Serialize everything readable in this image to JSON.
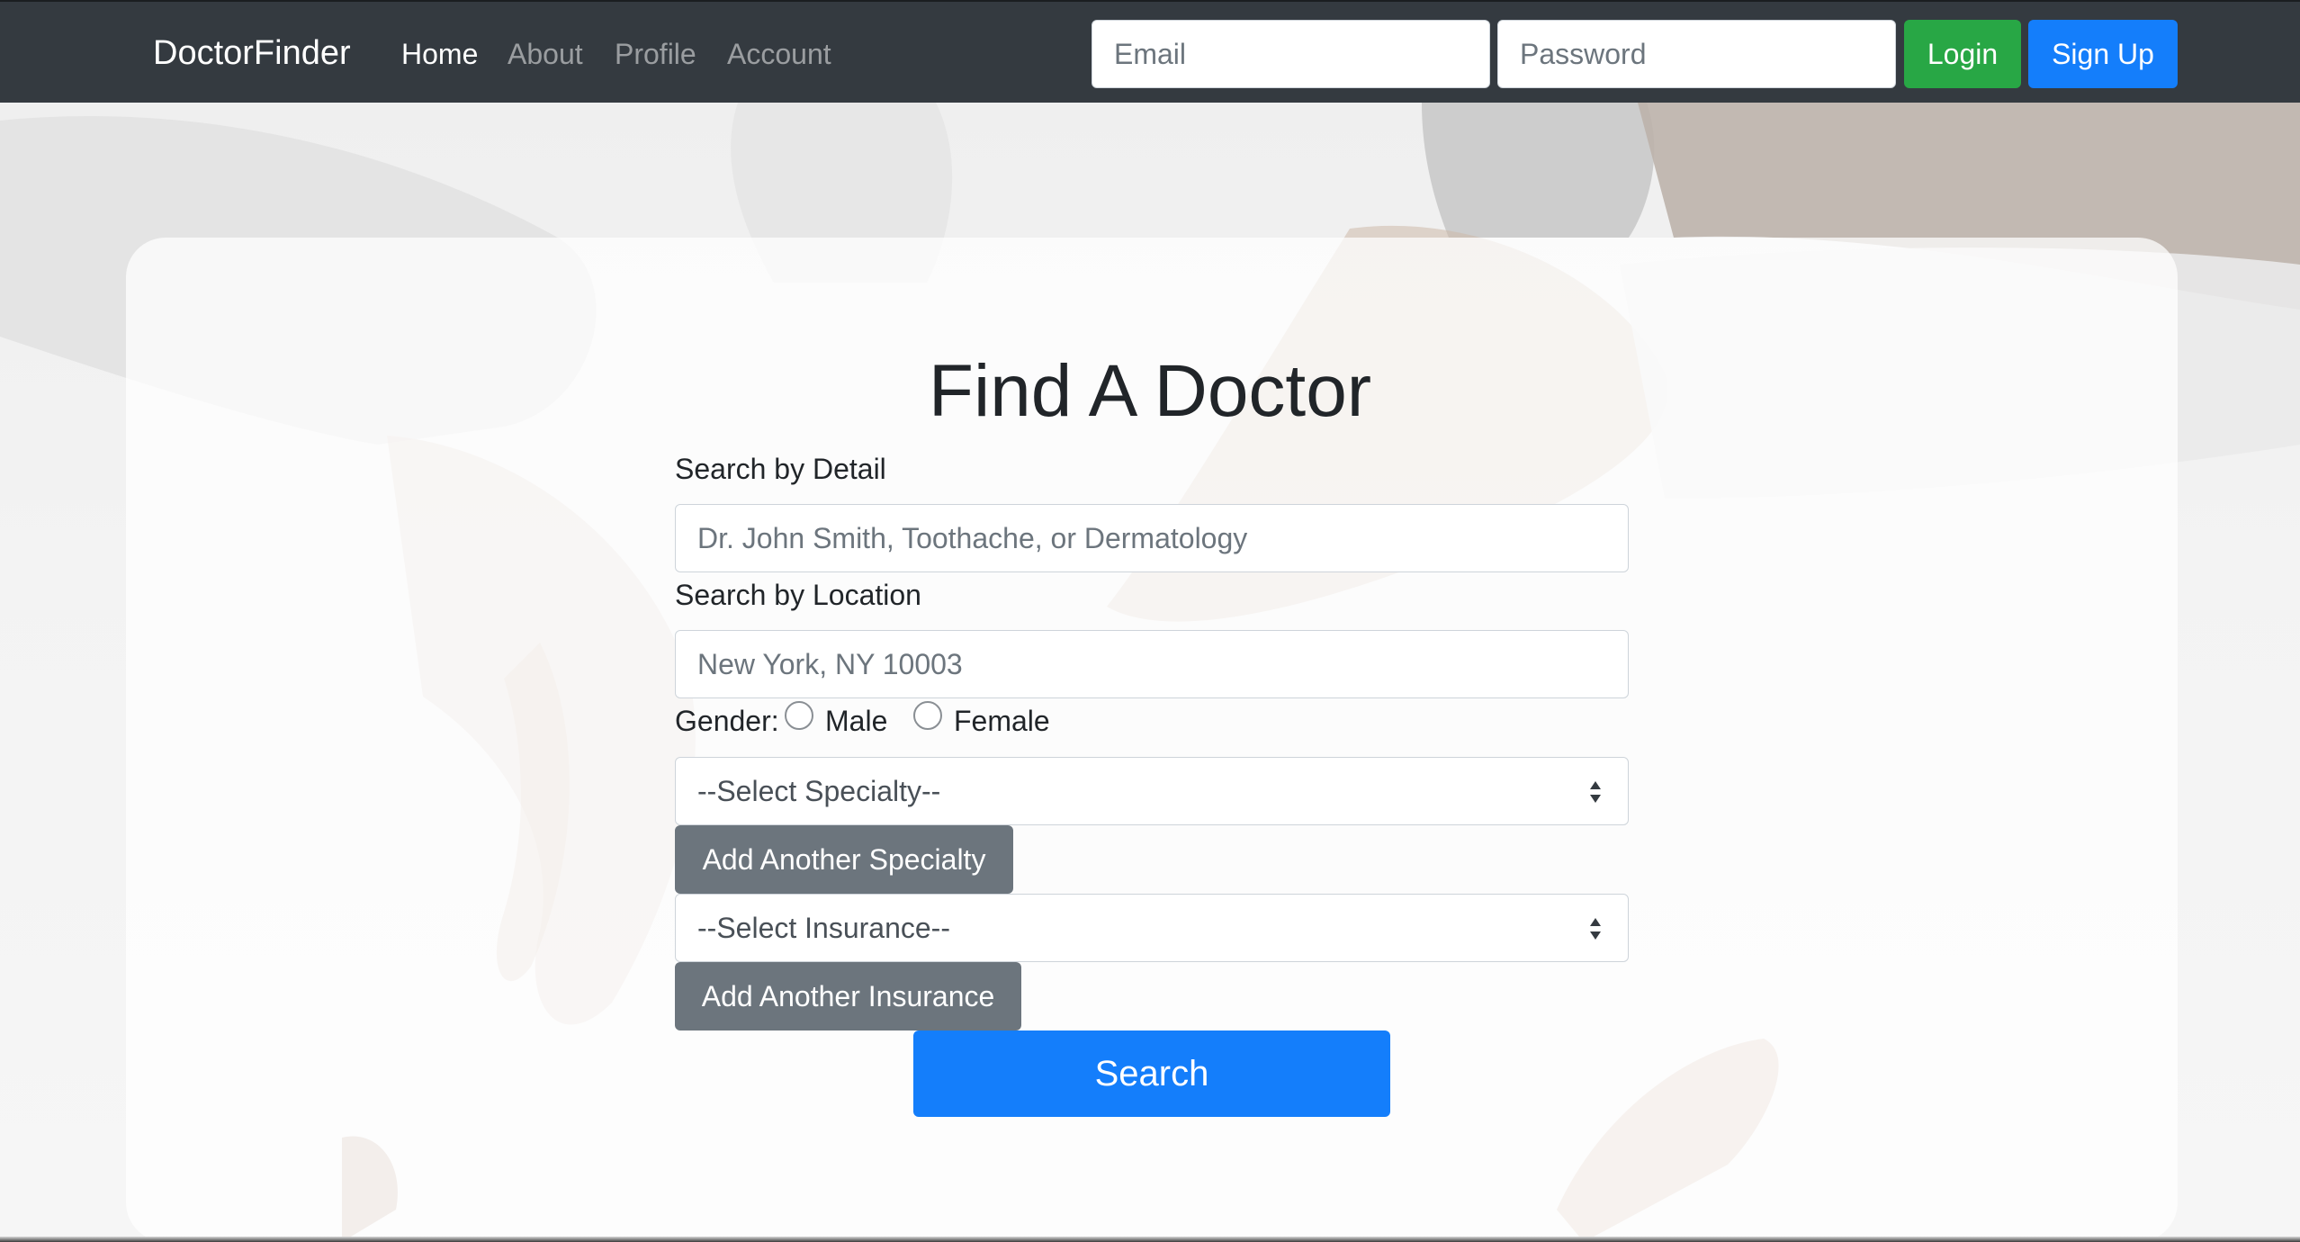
{
  "navbar": {
    "brand": "DoctorFinder",
    "links": [
      "Home",
      "About",
      "Profile",
      "Account"
    ],
    "active_link": "Home",
    "email_placeholder": "Email",
    "password_placeholder": "Password",
    "login_label": "Login",
    "signup_label": "Sign Up"
  },
  "form": {
    "title": "Find A Doctor",
    "detail_label": "Search by Detail",
    "detail_placeholder": "Dr. John Smith, Toothache, or Dermatology",
    "location_label": "Search by Location",
    "location_placeholder": "New York, NY 10003",
    "gender_label": "Gender:",
    "gender_options": [
      "Male",
      "Female"
    ],
    "specialty_selected": "--Select Specialty--",
    "add_specialty_label": "Add Another Specialty",
    "insurance_selected": "--Select Insurance--",
    "add_insurance_label": "Add Another Insurance",
    "search_label": "Search"
  },
  "colors": {
    "navbar_bg": "#343a40",
    "login_green": "#28a745",
    "primary_blue": "#147efb",
    "secondary_gray": "#6c757d"
  }
}
